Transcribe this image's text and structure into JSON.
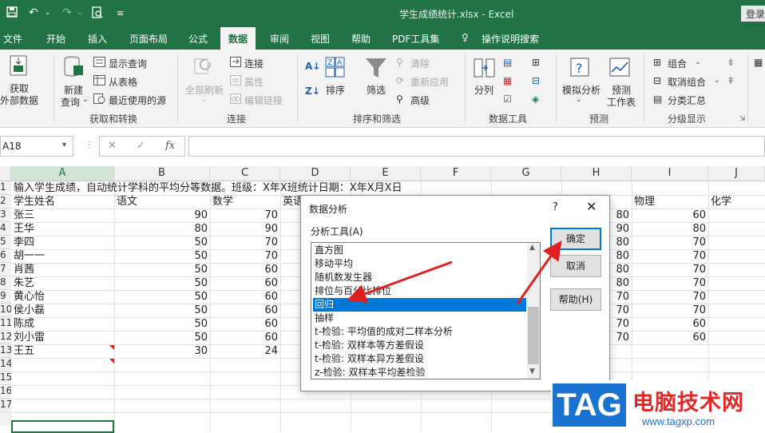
{
  "titlebar": {
    "document_title": "学生成绩统计.xlsx  -  Excel",
    "login": "登录"
  },
  "tabs": [
    "文件",
    "开始",
    "插入",
    "页面布局",
    "公式",
    "数据",
    "审阅",
    "视图",
    "帮助",
    "PDF工具集",
    "操作说明搜索"
  ],
  "ribbon": {
    "get_external": "获取",
    "get_external2": "外部数据",
    "new_query": "新建",
    "new_query2": "查询",
    "show_queries": "显示查询",
    "from_table": "从表格",
    "recent_sources": "最近使用的源",
    "group_get_transform": "获取和转换",
    "refresh_all": "全部刷新",
    "connections": "连接",
    "properties": "属性",
    "edit_links": "编辑链接",
    "group_connections": "连接",
    "sort": "排序",
    "filter": "筛选",
    "clear": "清除",
    "reapply": "重新应用",
    "advanced": "高级",
    "group_sort_filter": "排序和筛选",
    "text_to_columns": "分列",
    "group_data_tools": "数据工具",
    "what_if": "模拟分析",
    "forecast_sheet": "预测",
    "forecast_sheet2": "工作表",
    "group_forecast": "预测",
    "group_btn": "组合",
    "ungroup": "取消组合",
    "subtotal": "分类汇总",
    "group_outline": "分级显示"
  },
  "formula_bar": {
    "name_box": "A18",
    "cancel": "✕",
    "enter": "✓",
    "fx": "fx"
  },
  "columns": [
    "A",
    "B",
    "C",
    "D",
    "E",
    "F",
    "G",
    "H",
    "I",
    "J"
  ],
  "rows": [
    "1",
    "2",
    "3",
    "4",
    "5",
    "6",
    "7",
    "8",
    "9",
    "10",
    "11",
    "12",
    "13",
    "14",
    "15",
    "16",
    "17"
  ],
  "sheet": {
    "row1_text": "输入学生成绩，自动统计学科的平均分等数据。班级：X年X班统计日期：X年X月X日",
    "headers": {
      "a": "学生姓名",
      "b": "语文",
      "c": "数学",
      "d": "英语",
      "i": "物理",
      "j": "化学"
    },
    "names": [
      "张三",
      "王华",
      "李四",
      "胡一一",
      "肖茜",
      "朱艺",
      "黄心怡",
      "侯小磊",
      "陈成",
      "刘小雷",
      "王五"
    ],
    "chinese": [
      "90",
      "80",
      "50",
      "50",
      "50",
      "50",
      "50",
      "50",
      "50",
      "50",
      "30"
    ],
    "math": [
      "70",
      "90",
      "70",
      "70",
      "60",
      "60",
      "60",
      "60",
      "60",
      "60",
      "24"
    ],
    "col_h": [
      "80",
      "90",
      "80",
      "80",
      "80",
      "80",
      "70",
      "70",
      "70",
      "70"
    ],
    "physics": [
      "60",
      "80",
      "70",
      "70",
      "70",
      "70",
      "70",
      "70",
      "60",
      "60"
    ]
  },
  "dialog": {
    "title": "数据分析",
    "help_glyph": "?",
    "close_glyph": "✕",
    "list_label": "分析工具(A)",
    "items": [
      "直方图",
      "移动平均",
      "随机数发生器",
      "排位与百分比排位",
      "回归",
      "抽样",
      "t-检验: 平均值的成对二样本分析",
      "t-检验: 双样本等方差假设",
      "t-检验: 双样本异方差假设",
      "z-检验: 双样本平均差检验"
    ],
    "selected_index": 4,
    "ok": "确定",
    "cancel": "取消",
    "help": "帮助(H)"
  },
  "watermark": {
    "logo": "TAG",
    "site_name": "电脑技术网",
    "url": "www.tagxp.com"
  },
  "colors": {
    "excel_green": "#217346",
    "selection_blue": "#0078d7",
    "arrow_red": "#e02020"
  }
}
